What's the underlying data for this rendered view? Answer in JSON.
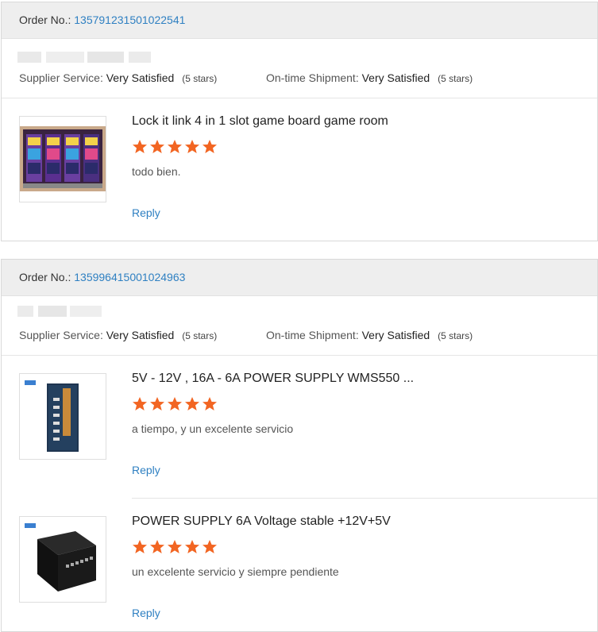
{
  "orders": [
    {
      "order_label": "Order No.:",
      "order_number": "135791231501022541",
      "supplier_label": "Supplier Service:",
      "supplier_value": "Very Satisfied",
      "supplier_stars": "(5 stars)",
      "shipment_label": "On-time Shipment:",
      "shipment_value": "Very Satisfied",
      "shipment_stars": "(5 stars)",
      "items": [
        {
          "title": "Lock it link 4 in 1 slot game board game room",
          "rating": 5,
          "comment": "todo bien.",
          "reply": "Reply",
          "thumb_icon": "slot-machines-image"
        }
      ]
    },
    {
      "order_label": "Order No.:",
      "order_number": "135996415001024963",
      "supplier_label": "Supplier Service:",
      "supplier_value": "Very Satisfied",
      "supplier_stars": "(5 stars)",
      "shipment_label": "On-time Shipment:",
      "shipment_value": "Very Satisfied",
      "shipment_stars": "(5 stars)",
      "items": [
        {
          "title": "5V - 12V , 16A - 6A POWER SUPPLY WMS550 ...",
          "rating": 5,
          "comment": "a tiempo, y un excelente servicio",
          "reply": "Reply",
          "thumb_icon": "power-supply-vertical-image"
        },
        {
          "title": "POWER SUPPLY 6A Voltage stable +12V+5V",
          "rating": 5,
          "comment": "un excelente servicio y siempre pendiente",
          "reply": "Reply",
          "thumb_icon": "power-supply-box-image"
        }
      ]
    }
  ],
  "colors": {
    "star": "#f26522",
    "link": "#2f80c2",
    "header_bg": "#eeeeee"
  }
}
